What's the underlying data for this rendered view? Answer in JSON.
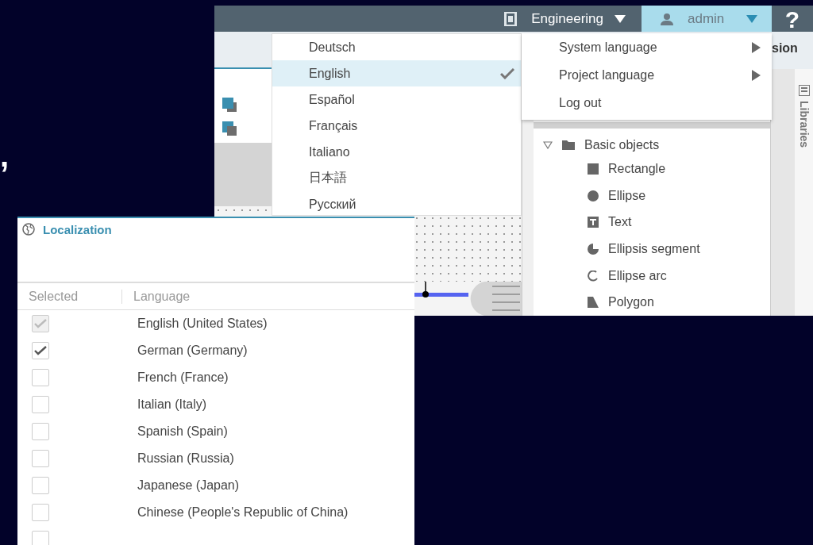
{
  "fragment_text": ",",
  "header": {
    "project": "Engineering",
    "user": "admin",
    "help": "?"
  },
  "toolbar": {
    "tab_fragment": "sion"
  },
  "language_menu": {
    "items": [
      {
        "label": "Deutsch",
        "selected": false
      },
      {
        "label": "English",
        "selected": true
      },
      {
        "label": "Español",
        "selected": false
      },
      {
        "label": "Français",
        "selected": false
      },
      {
        "label": "Italiano",
        "selected": false
      },
      {
        "label": "日本語",
        "selected": false
      },
      {
        "label": "Русский",
        "selected": false
      }
    ]
  },
  "user_menu": {
    "items": [
      {
        "label": "System language",
        "kind": "submenu"
      },
      {
        "label": "Project language",
        "kind": "submenu"
      },
      {
        "label": "Log out",
        "kind": "action"
      }
    ]
  },
  "tree": {
    "label": "Basic objects",
    "expanded": true,
    "children": [
      {
        "label": "Rectangle",
        "kind": "rectangle"
      },
      {
        "label": "Ellipse",
        "kind": "ellipse"
      },
      {
        "label": "Text",
        "kind": "text"
      },
      {
        "label": "Ellipsis segment",
        "kind": "segment"
      },
      {
        "label": "Ellipse arc",
        "kind": "arc"
      },
      {
        "label": "Polygon",
        "kind": "polygon"
      }
    ]
  },
  "side_tab": {
    "label": "Libraries"
  },
  "localization": {
    "title": "Localization",
    "columns": [
      "Selected",
      "Language"
    ],
    "rows": [
      {
        "checked": true,
        "disabled": true,
        "language": "English (United States)"
      },
      {
        "checked": true,
        "disabled": false,
        "language": "German (Germany)"
      },
      {
        "checked": false,
        "disabled": false,
        "language": "French (France)"
      },
      {
        "checked": false,
        "disabled": false,
        "language": "Italian (Italy)"
      },
      {
        "checked": false,
        "disabled": false,
        "language": "Spanish (Spain)"
      },
      {
        "checked": false,
        "disabled": false,
        "language": "Russian (Russia)"
      },
      {
        "checked": false,
        "disabled": false,
        "language": "Japanese (Japan)"
      },
      {
        "checked": false,
        "disabled": false,
        "language": "Chinese (People's Republic of China)"
      },
      {
        "checked": false,
        "disabled": false
      }
    ]
  }
}
